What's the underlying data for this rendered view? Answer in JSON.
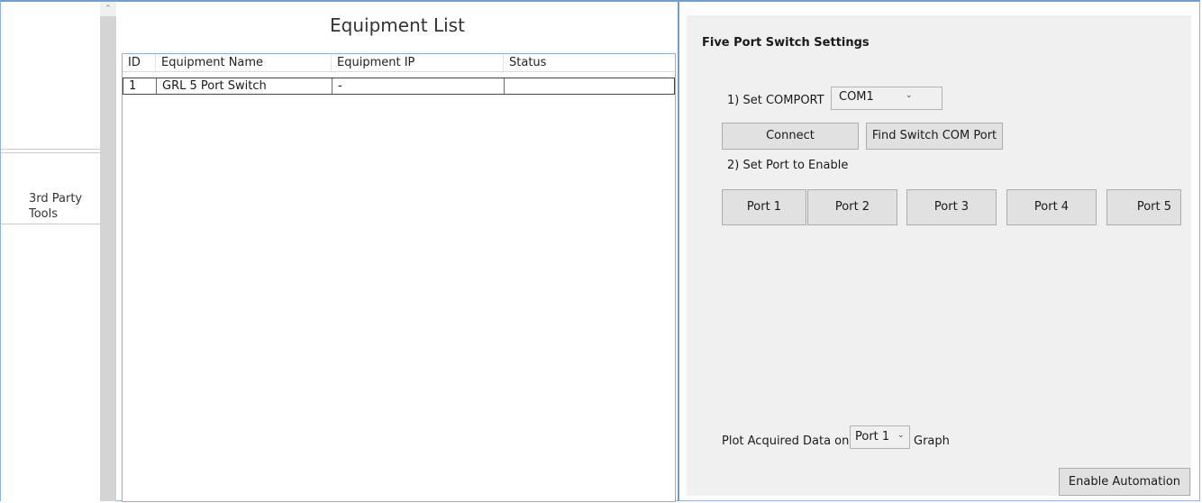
{
  "sidebar": {
    "tools_label": "3rd Party Tools"
  },
  "equipment_list": {
    "title": "Equipment List",
    "columns": [
      "ID",
      "Equipment Name",
      "Equipment IP",
      "Status"
    ],
    "rows": [
      {
        "id": "1",
        "name": "GRL 5 Port Switch",
        "ip": "-",
        "status": ""
      }
    ]
  },
  "settings": {
    "title": "Five Port Switch Settings",
    "set_comport_label": "1) Set COMPORT",
    "comport_value": "COM1",
    "connect_label": "Connect",
    "find_com_label": "Find Switch COM Port",
    "set_port_label": "2) Set Port to Enable",
    "ports": [
      "Port 1",
      "Port 2",
      "Port 3",
      "Port 4",
      "Port 5"
    ],
    "plot_label": "Plot Acquired Data on:",
    "plot_value": "Port 1",
    "graph_label": "Graph",
    "enable_automation_label": "Enable Automation"
  },
  "icons": {
    "dropdown": "chevron-down-icon",
    "scroll_up": "scroll-up-arrow-icon"
  },
  "colors": {
    "accent_border": "#6f9fd0",
    "panel_bg": "#f0f0f0",
    "button_bg": "#e1e1e1",
    "scrollbar": "#d4d4d4"
  }
}
